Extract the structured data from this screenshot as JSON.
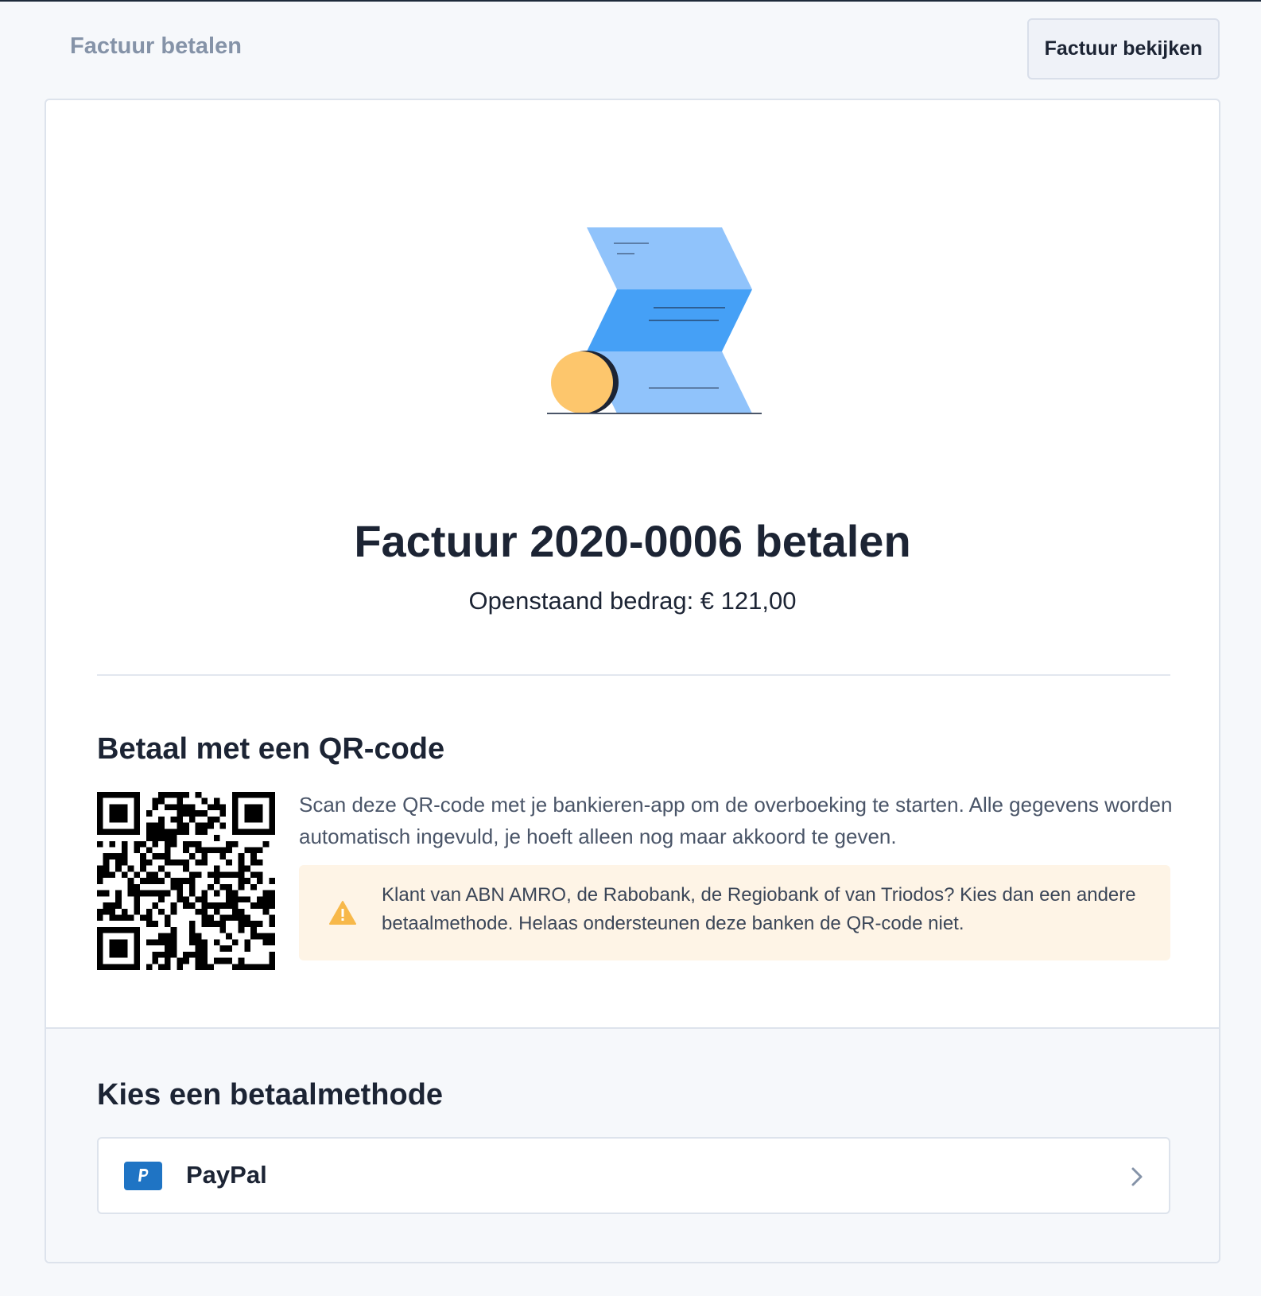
{
  "header": {
    "title": "Factuur betalen",
    "view_invoice_label": "Factuur bekijken"
  },
  "invoice": {
    "title": "Factuur 2020-0006 betalen",
    "amount_text": "Openstaand bedrag: € 121,00"
  },
  "qr_section": {
    "heading": "Betaal met een QR-code",
    "description": "Scan deze QR-code met je bankieren-app om de overboeking te starten. Alle gegevens worden automatisch ingevuld, je hoeft alleen nog maar akkoord te geven.",
    "warning": "Klant van ABN AMRO, de Rabobank, de Regiobank of van Triodos? Kies dan een andere betaalmethode. Helaas ondersteunen deze banken de QR-code niet."
  },
  "payment_methods": {
    "heading": "Kies een betaalmethode",
    "items": [
      {
        "label": "PayPal",
        "icon": "paypal-logo-icon"
      }
    ]
  },
  "icons": {
    "warning": "warning-triangle-icon",
    "chevron": "chevron-right-icon"
  },
  "colors": {
    "background": "#f6f8fb",
    "text": "#1c2434",
    "muted": "#8593a8",
    "illustration_light": "#90c3fb",
    "illustration_dark": "#45a0f6",
    "coin": "#fdc66c",
    "warning_bg": "#fef4e6",
    "warning_icon": "#f7b84a",
    "paypal": "#1f74c4"
  }
}
